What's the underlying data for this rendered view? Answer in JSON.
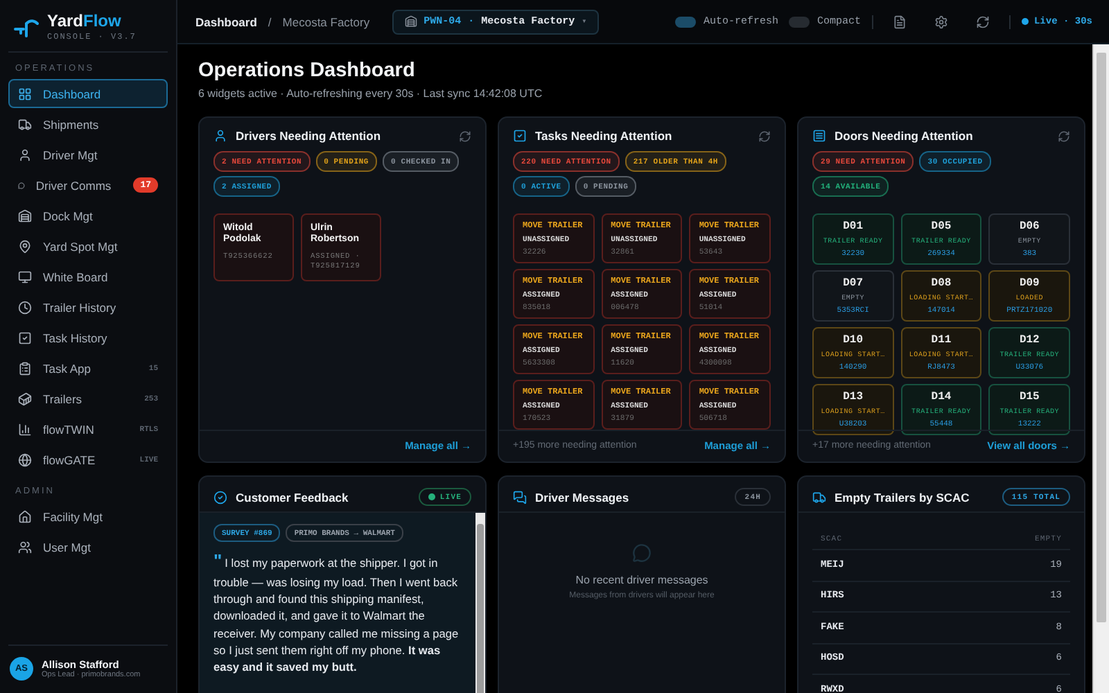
{
  "brand": {
    "name_a": "Yard",
    "name_b": "Flow",
    "subtitle": "CONSOLE · V3.7"
  },
  "sidebar": {
    "sections": [
      {
        "title": "OPERATIONS",
        "items": [
          {
            "label": "Dashboard",
            "selected": true
          },
          {
            "label": "Shipments",
            "selected": false
          },
          {
            "label": "Driver Mgt",
            "selected": false
          },
          {
            "label": "Driver Comms",
            "selected": false,
            "badge": {
              "text": "17",
              "kind": "alert"
            }
          },
          {
            "label": "Dock Mgt",
            "selected": false
          },
          {
            "label": "Yard Spot Mgt",
            "selected": false
          },
          {
            "label": "White Board",
            "selected": false
          },
          {
            "label": "Trailer History",
            "selected": false
          },
          {
            "label": "Task History",
            "selected": false
          },
          {
            "label": "Task App",
            "selected": false,
            "badge": {
              "text": "15",
              "kind": "meta"
            }
          },
          {
            "label": "Trailers",
            "selected": false,
            "badge": {
              "text": "253",
              "kind": "meta"
            }
          },
          {
            "label": "flowTWIN",
            "selected": false,
            "badge": {
              "text": "RTLS",
              "kind": "meta"
            }
          },
          {
            "label": "flowGATE",
            "selected": false,
            "badge": {
              "text": "LIVE",
              "kind": "meta"
            }
          }
        ]
      },
      {
        "title": "ADMIN",
        "items": [
          {
            "label": "Facility Mgt",
            "selected": false
          },
          {
            "label": "User Mgt",
            "selected": false
          }
        ]
      }
    ],
    "user": {
      "initials": "AS",
      "name": "Allison Stafford",
      "role": "Ops Lead · primobrands.com"
    }
  },
  "topbar": {
    "breadcrumb": [
      "Dashboard",
      "Mecosta Factory"
    ],
    "separator": "/",
    "facility": {
      "code": "PWN-04",
      "sep": "·",
      "name": "Mecosta Factory",
      "caret": "▾"
    },
    "toggles": [
      {
        "label": "Auto-refresh",
        "on": true
      },
      {
        "label": "Compact",
        "on": false
      }
    ],
    "live": "Live · 30s"
  },
  "page": {
    "title": "Operations Dashboard",
    "subtitle": "6 widgets active · Auto-refreshing every 30s · Last sync 14:42:08 UTC"
  },
  "drivers": {
    "title": "Drivers Needing Attention",
    "chips": [
      {
        "text": "2 NEED ATTENTION",
        "color": "#e5483b"
      },
      {
        "text": "0 PENDING",
        "color": "#e0a019"
      },
      {
        "text": "0 CHECKED IN",
        "color": "#8a929c"
      },
      {
        "text": "2 ASSIGNED",
        "color": "#1e9fd8"
      }
    ],
    "cards": [
      {
        "name": "Witold Podolak",
        "detail": "T925366622"
      },
      {
        "name": "Ulrin Robertson",
        "detail": "ASSIGNED · T925817129"
      }
    ],
    "link": "Manage all →"
  },
  "tasks": {
    "title": "Tasks Needing Attention",
    "chips": [
      {
        "text": "220 NEED ATTENTION",
        "color": "#e5483b"
      },
      {
        "text": "217 OLDER THAN 4H",
        "color": "#e0a019"
      },
      {
        "text": "0 ACTIVE",
        "color": "#1e9fd8"
      },
      {
        "text": "0 PENDING",
        "color": "#8a929c"
      }
    ],
    "cards": [
      {
        "title": "MOVE TRAILER",
        "status": "UNASSIGNED",
        "id": "32226"
      },
      {
        "title": "MOVE TRAILER",
        "status": "UNASSIGNED",
        "id": "32861"
      },
      {
        "title": "MOVE TRAILER",
        "status": "UNASSIGNED",
        "id": "53643"
      },
      {
        "title": "MOVE TRAILER",
        "status": "ASSIGNED",
        "id": "835018"
      },
      {
        "title": "MOVE TRAILER",
        "status": "ASSIGNED",
        "id": "006478"
      },
      {
        "title": "MOVE TRAILER",
        "status": "ASSIGNED",
        "id": "51014"
      },
      {
        "title": "MOVE TRAILER",
        "status": "ASSIGNED",
        "id": "5633308"
      },
      {
        "title": "MOVE TRAILER",
        "status": "ASSIGNED",
        "id": "11620"
      },
      {
        "title": "MOVE TRAILER",
        "status": "ASSIGNED",
        "id": "4300098"
      },
      {
        "title": "MOVE TRAILER",
        "status": "ASSIGNED",
        "id": "170523"
      },
      {
        "title": "MOVE TRAILER",
        "status": "ASSIGNED",
        "id": "31879"
      },
      {
        "title": "MOVE TRAILER",
        "status": "ASSIGNED",
        "id": "506718"
      }
    ],
    "more": "+195 more needing attention",
    "link": "Manage all →"
  },
  "doors": {
    "title": "Doors Needing Attention",
    "chips": [
      {
        "text": "29 NEED ATTENTION",
        "color": "#e5483b"
      },
      {
        "text": "30 OCCUPIED",
        "color": "#1e9fd8"
      },
      {
        "text": "14 AVAILABLE",
        "color": "#22b07a"
      }
    ],
    "cards": [
      {
        "door": "D01",
        "status": "TRAILER READY",
        "ref": "32230",
        "kind": "ready"
      },
      {
        "door": "D05",
        "status": "TRAILER READY",
        "ref": "269334",
        "kind": "ready"
      },
      {
        "door": "D06",
        "status": "EMPTY",
        "ref": "383",
        "kind": "empty"
      },
      {
        "door": "D07",
        "status": "EMPTY",
        "ref": "5353RCI",
        "kind": "empty"
      },
      {
        "door": "D08",
        "status": "LOADING START…",
        "ref": "147014",
        "kind": "loading"
      },
      {
        "door": "D09",
        "status": "LOADED",
        "ref": "PRTZ171020",
        "kind": "loading"
      },
      {
        "door": "D10",
        "status": "LOADING START…",
        "ref": "140290",
        "kind": "loading"
      },
      {
        "door": "D11",
        "status": "LOADING START…",
        "ref": "RJ8473",
        "kind": "loading"
      },
      {
        "door": "D12",
        "status": "TRAILER READY",
        "ref": "U33076",
        "kind": "ready"
      },
      {
        "door": "D13",
        "status": "LOADING START…",
        "ref": "U38203",
        "kind": "loading"
      },
      {
        "door": "D14",
        "status": "TRAILER READY",
        "ref": "55448",
        "kind": "ready"
      },
      {
        "door": "D15",
        "status": "TRAILER READY",
        "ref": "13222",
        "kind": "ready"
      }
    ],
    "more": "+17 more needing attention",
    "link": "View all doors →"
  },
  "feedback": {
    "title": "Customer Feedback",
    "badge": "LIVE",
    "tags": [
      "SURVEY #869",
      "PRIMO BRANDS → WALMART"
    ],
    "quote_mark": "\"",
    "text": "I lost my paperwork at the shipper. I got in trouble — was losing my load. Then I went back through and found this shipping manifest, downloaded it, and gave it to Walmart the receiver. My company called me missing a page so I just sent them right off my phone. **It was easy and it saved my butt.**"
  },
  "messages": {
    "title": "Driver Messages",
    "badge": "24H",
    "empty_title": "No recent driver messages",
    "empty_text": "Messages from drivers will appear here"
  },
  "scac": {
    "title": "Empty Trailers by SCAC",
    "badge": "115 TOTAL",
    "columns": [
      "SCAC",
      "EMPTY"
    ],
    "rows": [
      [
        "MEIJ",
        "19"
      ],
      [
        "HIRS",
        "13"
      ],
      [
        "FAKE",
        "8"
      ],
      [
        "HOSD",
        "6"
      ],
      [
        "RWXD",
        "6"
      ]
    ]
  }
}
